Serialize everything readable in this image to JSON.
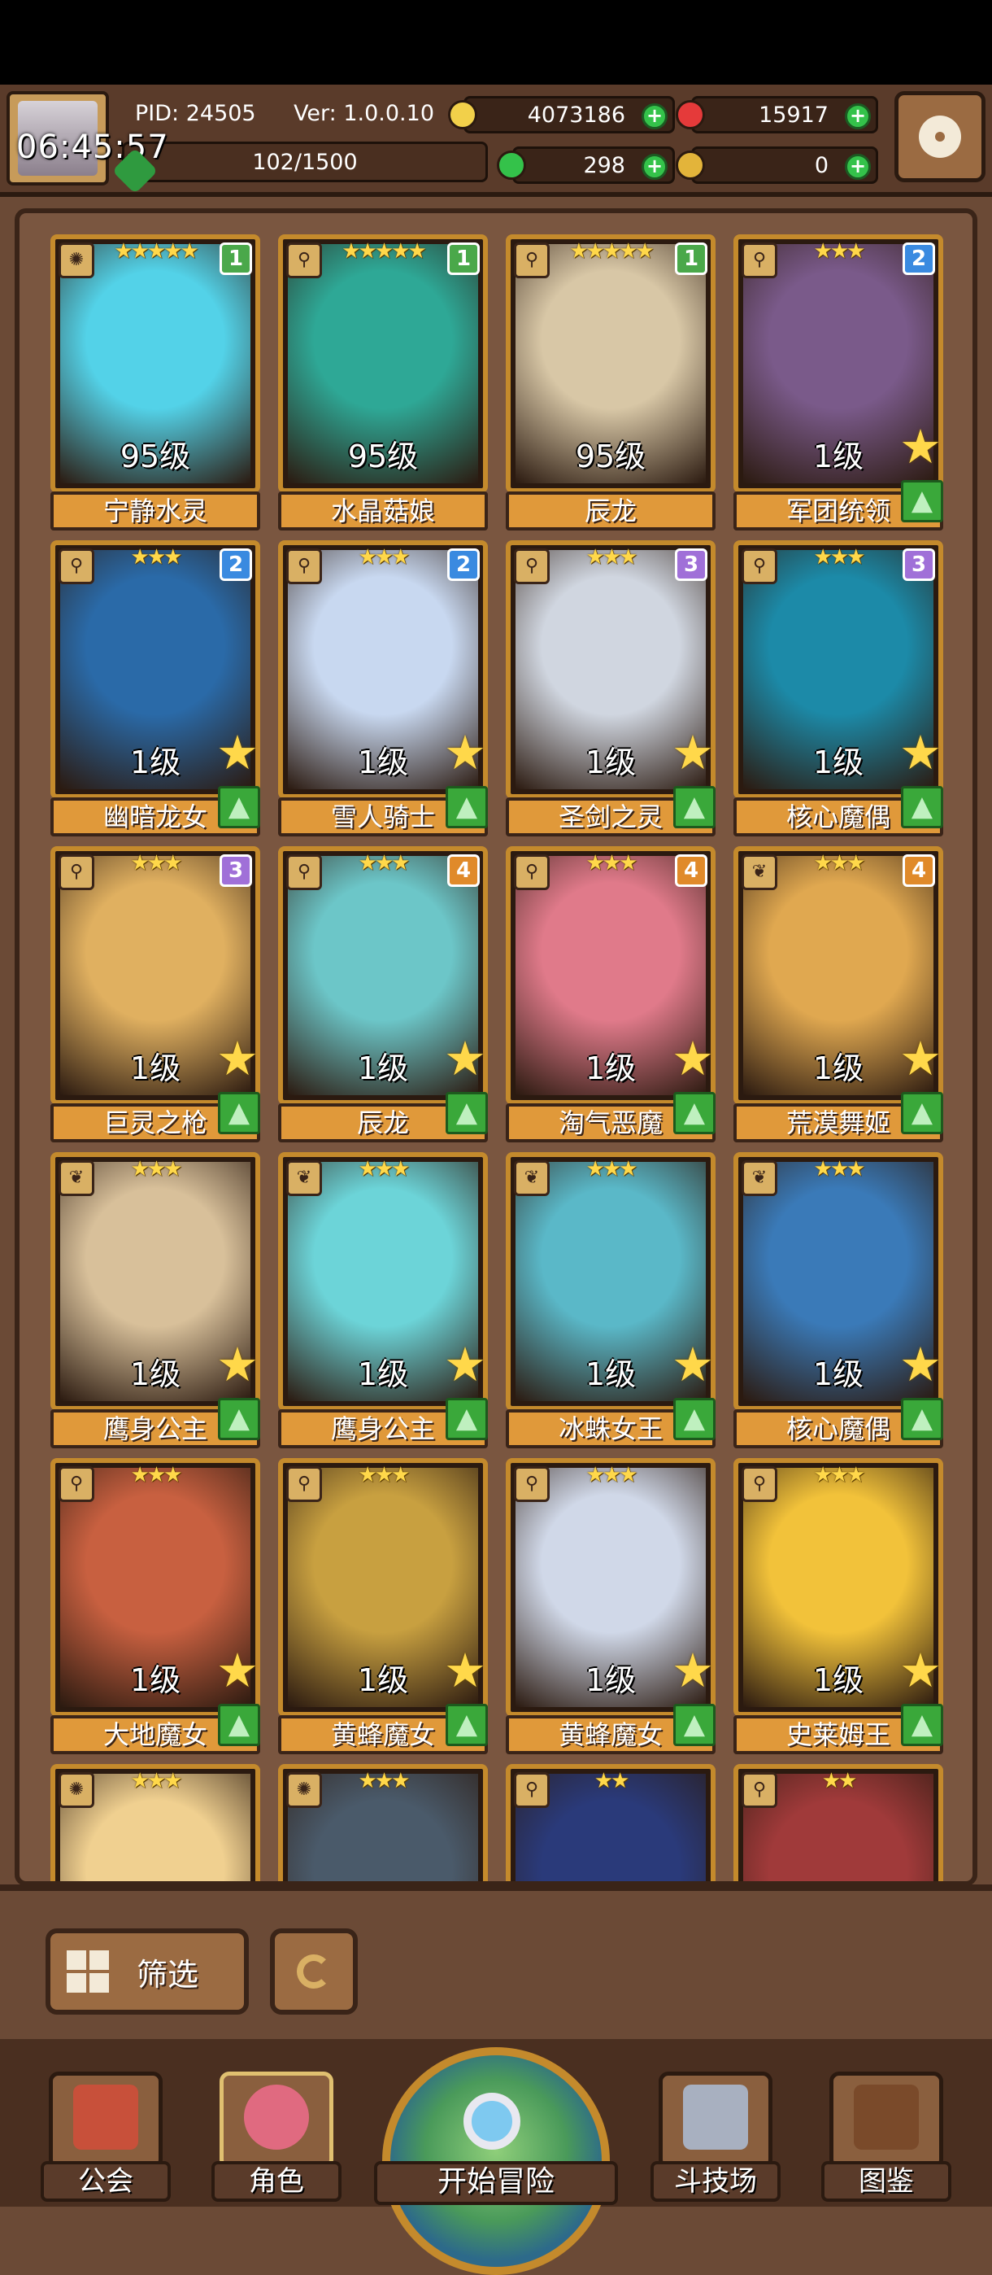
{
  "status": {
    "time": "06:45:57"
  },
  "header": {
    "pid_label": "PID: 24505",
    "version_label": "Ver: 1.0.0.10",
    "level_progress": "102/1500",
    "resources": {
      "gold": "4073186",
      "gems": "15917",
      "clover": "298",
      "key": "0"
    },
    "resource_colors": {
      "gold": "#f2d04a",
      "gems": "#e53a3a",
      "clover": "#34c24a",
      "key": "#e3b43a"
    }
  },
  "cards": [
    {
      "name": "宁静水灵",
      "level": "95级",
      "rank": "1",
      "stars": "★★★★★",
      "element": "sun",
      "color": "#53d2e8"
    },
    {
      "name": "水晶菇娘",
      "level": "95级",
      "rank": "1",
      "stars": "★★★★★",
      "element": "staff",
      "color": "#2ea896"
    },
    {
      "name": "辰龙",
      "level": "95级",
      "rank": "1",
      "stars": "★★★★★",
      "element": "staff",
      "color": "#d8c7a6"
    },
    {
      "name": "军团统领",
      "level": "1级",
      "rank": "2",
      "stars": "★★★",
      "element": "staff",
      "color": "#7a5a8a"
    },
    {
      "name": "幽暗龙女",
      "level": "1级",
      "rank": "2",
      "stars": "★★★",
      "element": "staff",
      "color": "#2a6aa8"
    },
    {
      "name": "雪人骑士",
      "level": "1级",
      "rank": "2",
      "stars": "★★★",
      "element": "staff",
      "color": "#c8d8f0"
    },
    {
      "name": "圣剑之灵",
      "level": "1级",
      "rank": "3",
      "stars": "★★★",
      "element": "staff",
      "color": "#d0d6e0"
    },
    {
      "name": "核心魔偶",
      "level": "1级",
      "rank": "3",
      "stars": "★★★",
      "element": "staff",
      "color": "#1c8aa8"
    },
    {
      "name": "巨灵之枪",
      "level": "1级",
      "rank": "3",
      "stars": "★★★",
      "element": "staff",
      "color": "#e0b060"
    },
    {
      "name": "辰龙",
      "level": "1级",
      "rank": "4",
      "stars": "★★★",
      "element": "staff",
      "color": "#6cc6c8"
    },
    {
      "name": "淘气恶魔",
      "level": "1级",
      "rank": "4",
      "stars": "★★★",
      "element": "staff",
      "color": "#e07a8a"
    },
    {
      "name": "荒漠舞姬",
      "level": "1级",
      "rank": "4",
      "stars": "★★★",
      "element": "leaf",
      "color": "#e0a850"
    },
    {
      "name": "鹰身公主",
      "level": "1级",
      "rank": "",
      "stars": "★★★",
      "element": "leaf",
      "color": "#d8c09a"
    },
    {
      "name": "鹰身公主",
      "level": "1级",
      "rank": "",
      "stars": "★★★",
      "element": "leaf",
      "color": "#6cd4d8"
    },
    {
      "name": "冰蛛女王",
      "level": "1级",
      "rank": "",
      "stars": "★★★",
      "element": "leaf",
      "color": "#5ab8c8"
    },
    {
      "name": "核心魔偶",
      "level": "1级",
      "rank": "",
      "stars": "★★★",
      "element": "leaf",
      "color": "#3a7ab8"
    },
    {
      "name": "大地魔女",
      "level": "1级",
      "rank": "",
      "stars": "★★★",
      "element": "staff",
      "color": "#c86040"
    },
    {
      "name": "黄蜂魔女",
      "level": "1级",
      "rank": "",
      "stars": "★★★",
      "element": "staff",
      "color": "#c8a040"
    },
    {
      "name": "黄蜂魔女",
      "level": "1级",
      "rank": "",
      "stars": "★★★",
      "element": "staff",
      "color": "#d0d8e8"
    },
    {
      "name": "史莱姆王",
      "level": "1级",
      "rank": "",
      "stars": "★★★",
      "element": "staff",
      "color": "#f2c23a"
    },
    {
      "name": "",
      "level": "",
      "rank": "",
      "stars": "★★★",
      "element": "sun",
      "color": "#f0d090"
    },
    {
      "name": "",
      "level": "",
      "rank": "",
      "stars": "★★★",
      "element": "sun",
      "color": "#4a5a6a"
    },
    {
      "name": "",
      "level": "",
      "rank": "",
      "stars": "★★",
      "element": "staff",
      "color": "#2a3a7a"
    },
    {
      "name": "",
      "level": "",
      "rank": "",
      "stars": "★★",
      "element": "staff",
      "color": "#a03a3a"
    }
  ],
  "rank_colors": {
    "1": "#4aa84a",
    "2": "#3a8ae0",
    "3": "#a070d8",
    "4": "#e08a2a"
  },
  "filter": {
    "label": "筛选"
  },
  "nav": {
    "guild": "公会",
    "role": "角色",
    "adventure": "开始冒险",
    "arena": "斗技场",
    "codex": "图鉴"
  }
}
